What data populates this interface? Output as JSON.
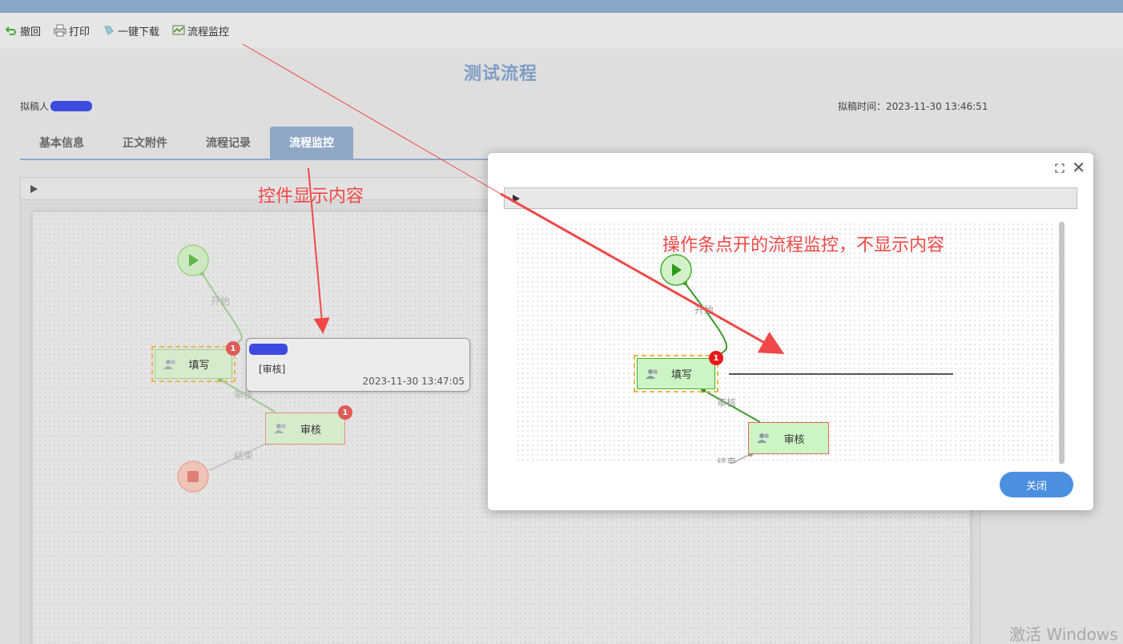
{
  "toolbar": {
    "items": [
      {
        "label": "撤回",
        "icon": "undo-icon"
      },
      {
        "label": "打印",
        "icon": "printer-icon"
      },
      {
        "label": "一键下载",
        "icon": "download-icon"
      },
      {
        "label": "流程监控",
        "icon": "monitor-icon"
      }
    ]
  },
  "header": {
    "title": "测试流程",
    "drafter_label": "拟稿人",
    "draft_time": "拟稿时间：2023-11-30 13:46:51"
  },
  "tabs": [
    {
      "label": "基本信息",
      "active": false
    },
    {
      "label": "正文附件",
      "active": false
    },
    {
      "label": "流程记录",
      "active": false
    },
    {
      "label": "流程监控",
      "active": true
    }
  ],
  "flow": {
    "start_edge_label": "开始",
    "node_fill_label": "填写",
    "node_review_label": "审核",
    "review_edge_label": "审核",
    "end_edge_label": "结束",
    "fill_badge": "1",
    "review_badge": "1"
  },
  "tooltip": {
    "role": "[审核]",
    "time": "2023-11-30 13:47:05"
  },
  "annotations": {
    "left": "控件显示内容",
    "right": "操作条点开的流程监控，不显示内容"
  },
  "modal": {
    "start_edge_label": "开始",
    "node_fill_label": "填写",
    "node_review_label": "审核",
    "review_edge_label": "审核",
    "end_edge_label": "结束",
    "fill_badge": "1",
    "close_button": "关闭"
  },
  "watermark": "激活 Windows",
  "colors": {
    "accent": "#8fa8c6",
    "title": "#7f9dc4",
    "annotation": "#f04848",
    "node_fill": "#cbe8c4",
    "node_border": "#e0706a",
    "badge": "#e05a5a",
    "button": "#4a8fe0"
  }
}
